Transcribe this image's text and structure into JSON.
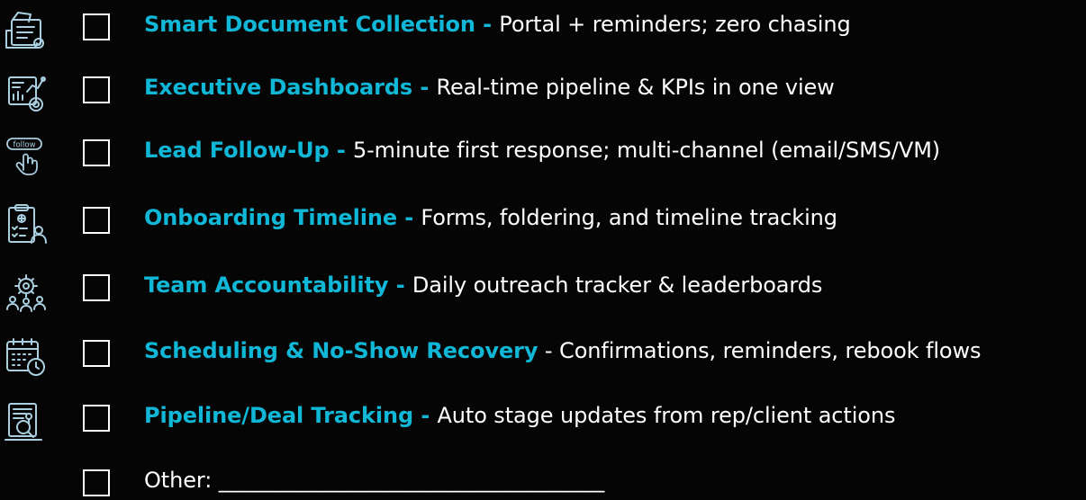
{
  "items": [
    {
      "icon": "document-collection-icon",
      "label": "Smart Document Collection",
      "separator": " - ",
      "description": "Portal + reminders; zero chasing"
    },
    {
      "icon": "dashboard-analytics-icon",
      "label": "Executive Dashboards",
      "separator": " - ",
      "description": "Real-time pipeline & KPIs in one view"
    },
    {
      "icon": "follow-click-icon",
      "icon_text": "follow",
      "label": "Lead Follow-Up",
      "separator": " - ",
      "description": "5-minute first response; multi-channel (email/SMS/VM)"
    },
    {
      "icon": "onboarding-clipboard-icon",
      "label": "Onboarding Timeline",
      "separator": " - ",
      "description": "Forms, foldering, and timeline tracking"
    },
    {
      "icon": "team-gear-icon",
      "label": "Team Accountability",
      "separator": " - ",
      "description": "Daily outreach tracker & leaderboards"
    },
    {
      "icon": "calendar-clock-icon",
      "label": "Scheduling & No-Show Recovery",
      "separator": " - ",
      "description": "Confirmations, reminders, rebook flows"
    },
    {
      "icon": "pipeline-search-icon",
      "label": "Pipeline/Deal Tracking",
      "separator": " - ",
      "description": "Auto stage updates from rep/client actions"
    }
  ],
  "other": {
    "text": "Other: ____________________________________"
  },
  "colors": {
    "background": "#050505",
    "label": "#10b7d6",
    "text": "#ffffff",
    "icon": "#a9cfe0"
  }
}
